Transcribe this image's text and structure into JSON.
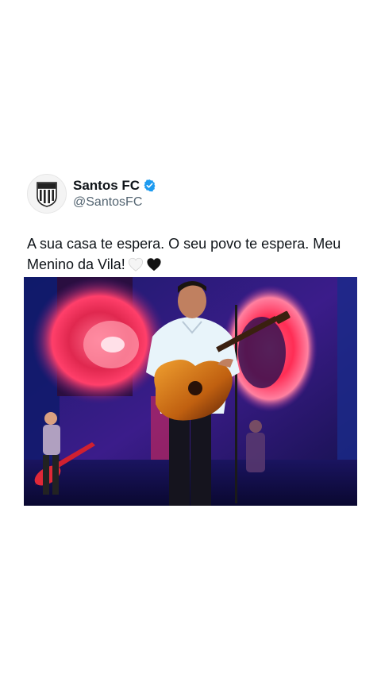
{
  "tweet": {
    "display_name": "Santos FC",
    "handle": "@SantosFC",
    "verified": true,
    "text": "A sua casa te espera. O seu povo te espera. Meu Menino da Vila!",
    "emojis": [
      "white-heart-icon",
      "black-heart-icon"
    ]
  },
  "colors": {
    "verified_badge": "#1d9bf0",
    "handle": "#536471",
    "text": "#0f1419"
  }
}
